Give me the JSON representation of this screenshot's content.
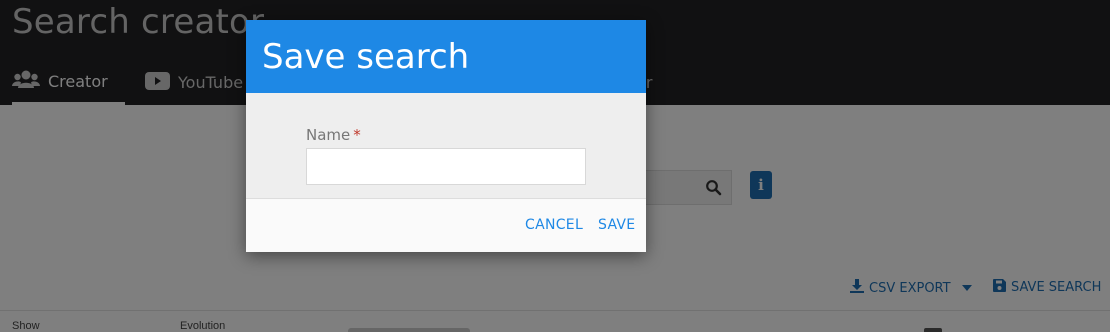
{
  "app": {
    "title": "Search creator"
  },
  "tabs": [
    {
      "label": "Creator",
      "icon": "users-icon",
      "active": true
    },
    {
      "label": "YouTube",
      "icon": "youtube-icon",
      "active": false
    },
    {
      "label": "er",
      "icon": "",
      "active": false
    }
  ],
  "search": {
    "value": "",
    "icon": "search-icon"
  },
  "info_button": {
    "label": "i"
  },
  "toolbar": {
    "csv_export_label": "CSV EXPORT",
    "save_search_label": "SAVE SEARCH"
  },
  "table": {
    "columns": [
      "Show",
      "Evolution"
    ]
  },
  "dialog": {
    "title": "Save search",
    "field_label": "Name",
    "required_mark": "*",
    "name_value": "",
    "cancel_label": "CANCEL",
    "save_label": "SAVE"
  },
  "colors": {
    "dialog_header": "#1e88e5",
    "accent_text": "#1f6fb3",
    "topbar": "#222325",
    "required": "#c0392b"
  }
}
